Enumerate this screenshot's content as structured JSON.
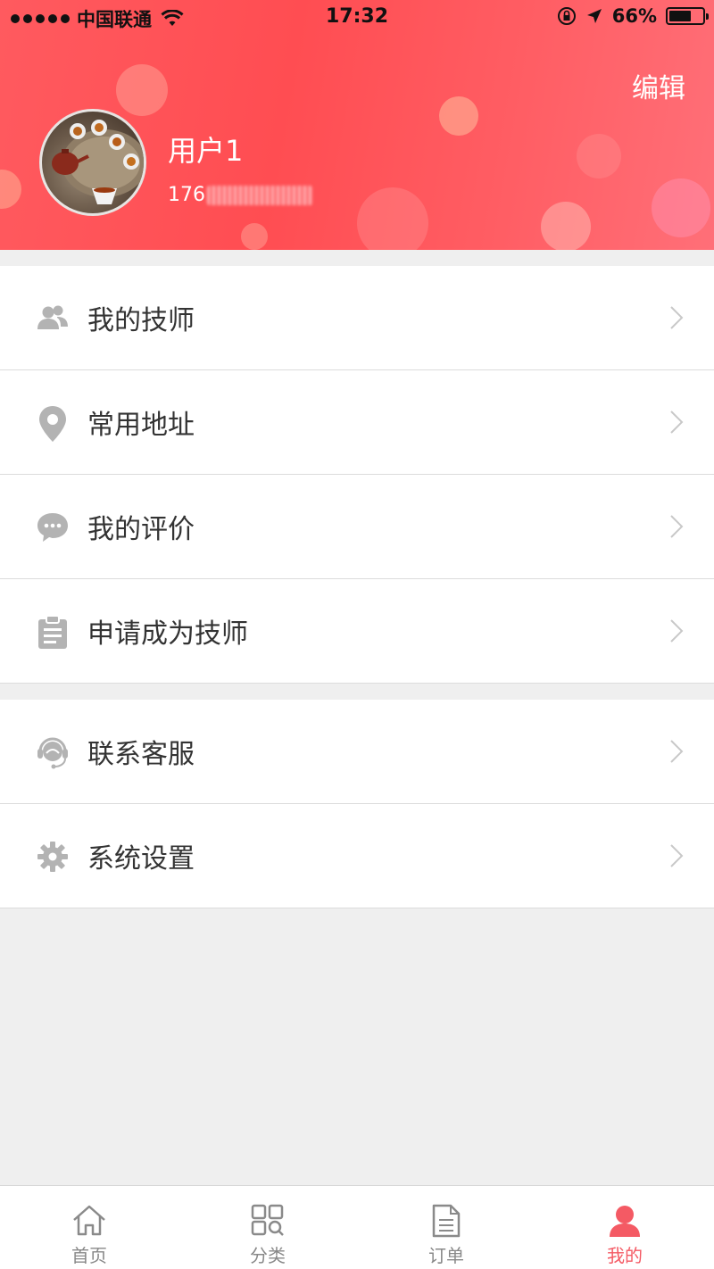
{
  "status_bar": {
    "carrier": "中国联通",
    "time": "17:32",
    "battery": "66%",
    "battery_level": 0.66
  },
  "header": {
    "edit_label": "编辑",
    "username": "用户1",
    "phone_prefix": "176"
  },
  "menu_group_1": [
    {
      "label": "我的技师",
      "icon": "users-icon"
    },
    {
      "label": "常用地址",
      "icon": "location-pin-icon"
    },
    {
      "label": "我的评价",
      "icon": "chat-bubble-icon"
    },
    {
      "label": "申请成为技师",
      "icon": "clipboard-icon"
    }
  ],
  "menu_group_2": [
    {
      "label": "联系客服",
      "icon": "headset-icon"
    },
    {
      "label": "系统设置",
      "icon": "gear-icon"
    }
  ],
  "tabbar": {
    "items": [
      {
        "label": "首页",
        "icon": "home-icon"
      },
      {
        "label": "分类",
        "icon": "category-icon"
      },
      {
        "label": "订单",
        "icon": "order-document-icon"
      },
      {
        "label": "我的",
        "icon": "profile-icon"
      }
    ],
    "active_index": 3,
    "active_color": "#f45a64",
    "inactive_color": "#888888"
  },
  "colors": {
    "header": "#ff5358",
    "icon_gray": "#b0b0b0",
    "background": "#efefef"
  }
}
